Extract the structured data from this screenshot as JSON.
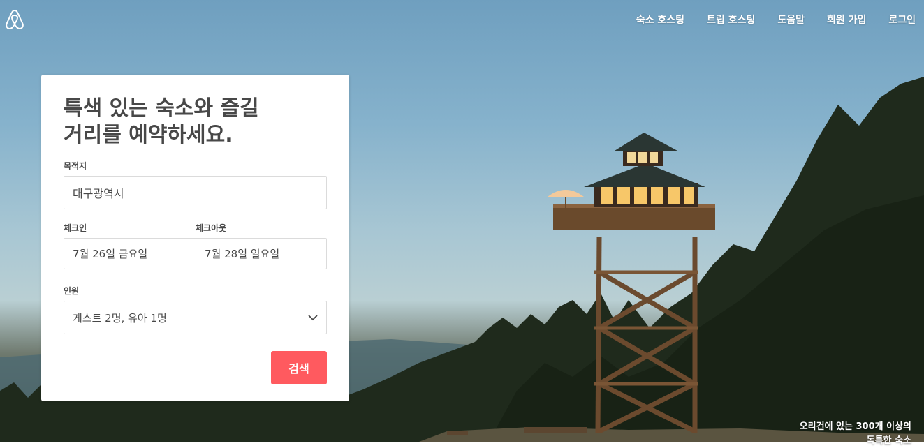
{
  "nav": {
    "links": [
      "숙소 호스팅",
      "트립 호스팅",
      "도움말",
      "회원 가입",
      "로그인"
    ]
  },
  "search_card": {
    "headline_line1": "특색 있는 숙소와 즐길",
    "headline_line2": "거리를 예약하세요.",
    "destination_label": "목적지",
    "destination_value": "대구광역시",
    "checkin_label": "체크인",
    "checkin_value": "7월 26일 금요일",
    "checkout_label": "체크아웃",
    "checkout_value": "7월 28일 일요일",
    "guests_label": "인원",
    "guests_value": "게스트 2명, 유아 1명",
    "search_button": "검색"
  },
  "caption": {
    "line1": "오리건에 있는 300개 이상의",
    "line2": "독특한 숙소"
  },
  "colors": {
    "accent": "#ff5a5f",
    "text": "#484848"
  },
  "icons": [
    "airbnb-logo-icon",
    "chevron-down-icon"
  ]
}
